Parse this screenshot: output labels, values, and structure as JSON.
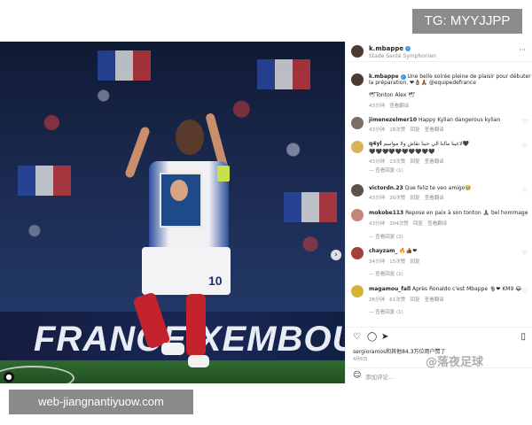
{
  "watermarks": {
    "top_right": "TG: MYYJJPP",
    "bottom_left": "web-jiangnantiyuow.com",
    "bottom_right": "@落夜足球"
  },
  "photo": {
    "banner_text": "FRANCE    XEMBOURG",
    "shorts_number": "10"
  },
  "post_header": {
    "username": "k.mbappe",
    "location": "Stade Santé Symphonien"
  },
  "caption": {
    "username": "k.mbappe",
    "text": "Une belle soirée pleine de plaisir pour débuter la préparation. ❤👌🏾🙏🏾 @equipedefrance",
    "second_line": "🕊Tonton Alex 🕊",
    "meta": "43分钟",
    "translate": "查看翻译"
  },
  "comments": [
    {
      "username": "jimenezelmer10",
      "text": "Happy Kylian dangerous kylian",
      "time": "43分钟",
      "likes": "28次赞",
      "reply": "回复",
      "translate": "查看翻译",
      "replies": ""
    },
    {
      "username": "q4yl",
      "text": "لاعبنا مالنا الي حبنا نقاش ولا مواسم🖤",
      "text2": "🖤🖤🖤🖤🖤🖤🖤🖤🖤🖤",
      "time": "43分钟",
      "likes": "23次赞",
      "reply": "回复",
      "translate": "查看翻译",
      "replies": "—  查看回复 (1)"
    },
    {
      "username": "victordn.23",
      "text": "Que feliz te veo amigo🥹",
      "time": "43分钟",
      "likes": "20次赞",
      "reply": "回复",
      "translate": "查看翻译",
      "replies": ""
    },
    {
      "username": "mokobe113",
      "text": "Repose en paix à son tonton 🙏🏾 bel hommage",
      "time": "43分钟",
      "likes": "204次赞",
      "reply": "回复",
      "translate": "查看翻译",
      "replies": "—  查看回复 (2)"
    },
    {
      "username": "chayzam_",
      "text": "🔥👍🏾❤",
      "time": "34分钟",
      "likes": "15次赞",
      "reply": "回复",
      "translate": "",
      "replies": "—  查看回复 (1)"
    },
    {
      "username": "magamou_fall",
      "text": "Après Ronaldo c'est Mbappe 🐐❤ KM9 😂",
      "time": "26分钟",
      "likes": "61次赞",
      "reply": "回复",
      "translate": "查看翻译",
      "replies": "—  查看回复 (1)"
    }
  ],
  "likes_line": "sergioramos和其他84.3万位用户赞了",
  "date_line": "4月6日",
  "add_comment_placeholder": "添加评论...",
  "colors": {
    "verified": "#3897f0",
    "text_primary": "#262626",
    "text_secondary": "#8e8e8e",
    "watermark_box": "#8b8b8b"
  },
  "icons": {
    "like": "heart-icon",
    "comment": "comment-icon",
    "share": "send-icon",
    "save": "bookmark-icon",
    "more": "more-options-icon",
    "emoji": "emoji-icon",
    "next": "chevron-right-icon"
  }
}
